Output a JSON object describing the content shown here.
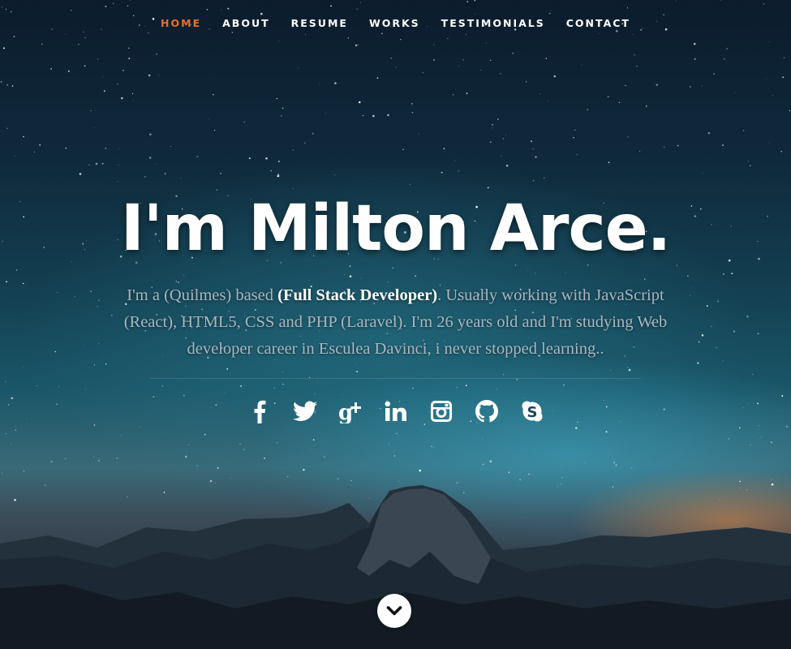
{
  "nav": {
    "items": [
      {
        "label": "HOME",
        "active": true
      },
      {
        "label": "ABOUT"
      },
      {
        "label": "RESUME"
      },
      {
        "label": "WORKS"
      },
      {
        "label": "TESTIMONIALS"
      },
      {
        "label": "CONTACT"
      }
    ],
    "active_color": "#e6712a"
  },
  "hero": {
    "headline": "I'm Milton Arce.",
    "intro": {
      "part1": "I'm a (Quilmes) based ",
      "highlight": "(Full Stack Developer)",
      "part2": ". Usually working with JavaScript (React), HTML5, CSS and PHP (Laravel). I'm 26 years old and I'm studying Web developer career in Esculea Davinci, i never stopped learning.."
    }
  },
  "social": [
    {
      "icon": "facebook-icon"
    },
    {
      "icon": "twitter-icon"
    },
    {
      "icon": "google-plus-icon"
    },
    {
      "icon": "linkedin-icon"
    },
    {
      "icon": "instagram-icon"
    },
    {
      "icon": "github-icon"
    },
    {
      "icon": "skype-icon"
    }
  ],
  "scroll": {
    "icon": "chevron-down-icon"
  }
}
